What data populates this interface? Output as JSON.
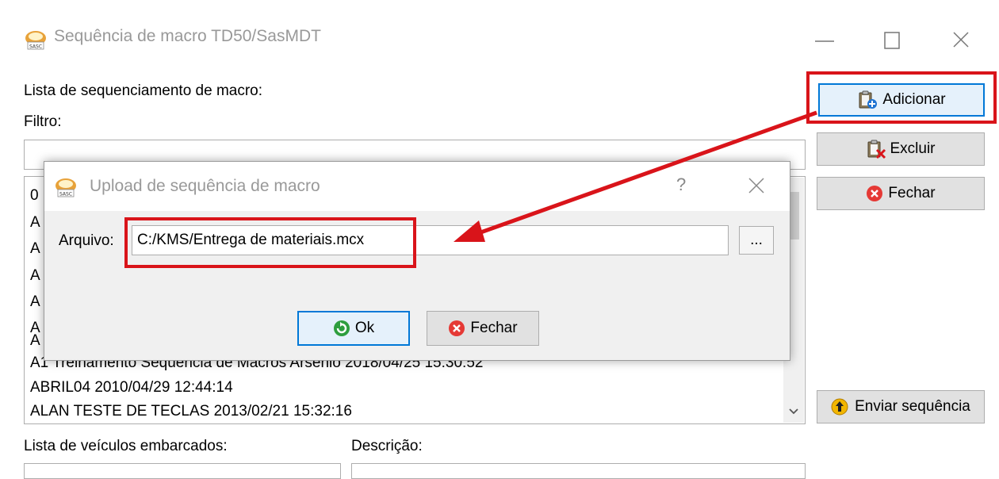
{
  "main_window": {
    "title": "Sequência de macro TD50/SasMDT",
    "list_label": "Lista de sequenciamento de macro:",
    "filter_label": "Filtro:",
    "filter_value": "",
    "list_items_partial": [
      "0",
      "A",
      "A",
      "A",
      "A",
      "A",
      "A"
    ],
    "list_items": [
      "A1 Treinamento Sequencia de Macros Arsenio 2018/04/25 15:30:52",
      "ABRIL04 2010/04/29 12:44:14",
      "ALAN TESTE DE TECLAS 2013/02/21 15:32:16"
    ],
    "buttons": {
      "add": "Adicionar",
      "delete": "Excluir",
      "close": "Fechar",
      "send": "Enviar sequência"
    },
    "vehicles_label": "Lista de veículos embarcados:",
    "description_label": "Descrição:"
  },
  "upload_dialog": {
    "title": "Upload de sequência de macro",
    "help": "?",
    "file_label": "Arquivo:",
    "file_value": "C:/KMS/Entrega de materiais.mcx",
    "browse": "...",
    "ok": "Ok",
    "close": "Fechar"
  },
  "colors": {
    "highlight": "#d9141a",
    "focus_border": "#0078d7",
    "button_face": "#e1e1e1"
  }
}
